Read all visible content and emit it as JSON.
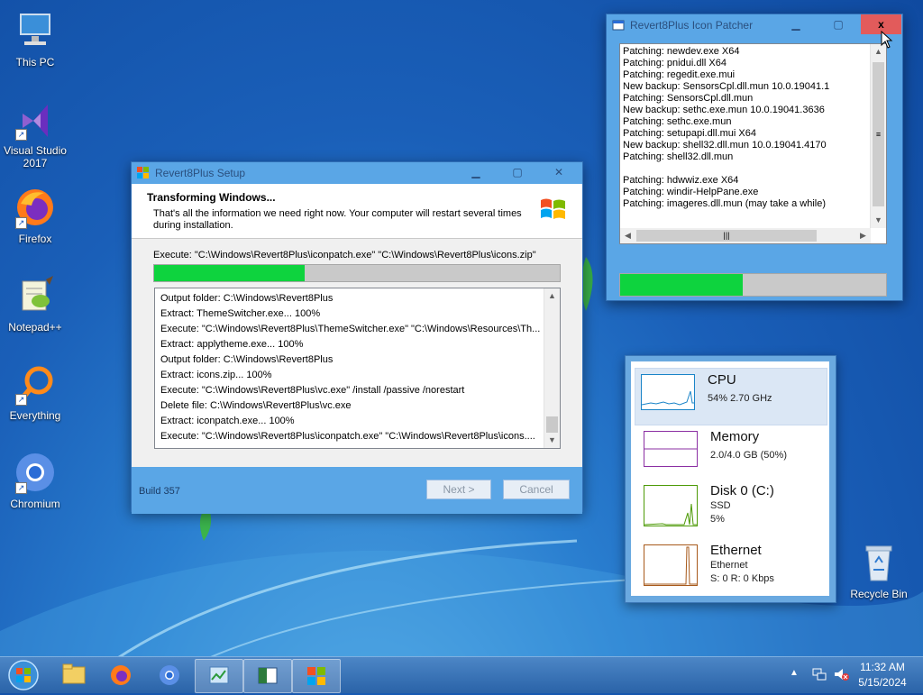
{
  "desktop": {
    "icons": [
      {
        "label": "This PC"
      },
      {
        "label": "Visual Studio 2017"
      },
      {
        "label": "Firefox"
      },
      {
        "label": "Notepad++"
      },
      {
        "label": "Everything"
      },
      {
        "label": "Chromium"
      },
      {
        "label": "Recycle Bin"
      }
    ]
  },
  "setup": {
    "title": "Revert8Plus Setup",
    "heading": "Transforming Windows...",
    "description": "That's all the information we need right now. Your computer will restart several times during installation.",
    "execute_line": "Execute: \"C:\\Windows\\Revert8Plus\\iconpatch.exe\" \"C:\\Windows\\Revert8Plus\\icons.zip\"",
    "progress": 0.37,
    "log": [
      "Output folder: C:\\Windows\\Revert8Plus",
      "Extract: ThemeSwitcher.exe... 100%",
      "Execute: \"C:\\Windows\\Revert8Plus\\ThemeSwitcher.exe\" \"C:\\Windows\\Resources\\Th...",
      "Extract: applytheme.exe... 100%",
      "Output folder: C:\\Windows\\Revert8Plus",
      "Extract: icons.zip... 100%",
      "Execute: \"C:\\Windows\\Revert8Plus\\vc.exe\" /install /passive /norestart",
      "Delete file: C:\\Windows\\Revert8Plus\\vc.exe",
      "Extract: iconpatch.exe... 100%",
      "Execute: \"C:\\Windows\\Revert8Plus\\iconpatch.exe\" \"C:\\Windows\\Revert8Plus\\icons...."
    ],
    "build": "Build 357",
    "next_label": "Next >",
    "cancel_label": "Cancel"
  },
  "patcher": {
    "title": "Revert8Plus Icon Patcher",
    "close_glyph": "x",
    "log": [
      "Patching: newdev.exe X64",
      "Patching: pnidui.dll X64",
      "Patching: regedit.exe.mui",
      "New backup: SensorsCpl.dll.mun 10.0.19041.1",
      "Patching: SensorsCpl.dll.mun",
      "New backup: sethc.exe.mun 10.0.19041.3636",
      "Patching: sethc.exe.mun",
      "Patching: setupapi.dll.mui X64",
      "New backup: shell32.dll.mun 10.0.19041.4170",
      "Patching: shell32.dll.mun",
      "",
      "Patching: hdwwiz.exe X64",
      "Patching: windir-HelpPane.exe",
      "Patching: imageres.dll.mun (may take a while)"
    ],
    "progress": 0.46
  },
  "taskmanager": {
    "cpu": {
      "title": "CPU",
      "detail": "54%  2.70 GHz",
      "color": "#1a84c8"
    },
    "memory": {
      "title": "Memory",
      "detail": "2.0/4.0 GB (50%)",
      "color": "#8b2fa3"
    },
    "disk": {
      "title": "Disk 0 (C:)",
      "type": "SSD",
      "detail": "5%",
      "color": "#4d9a06"
    },
    "ethernet": {
      "title": "Ethernet",
      "name": "Ethernet",
      "detail": "S: 0  R: 0 Kbps",
      "color": "#a7591a"
    }
  },
  "taskbar": {
    "time": "11:32 AM",
    "date": "5/15/2024"
  }
}
